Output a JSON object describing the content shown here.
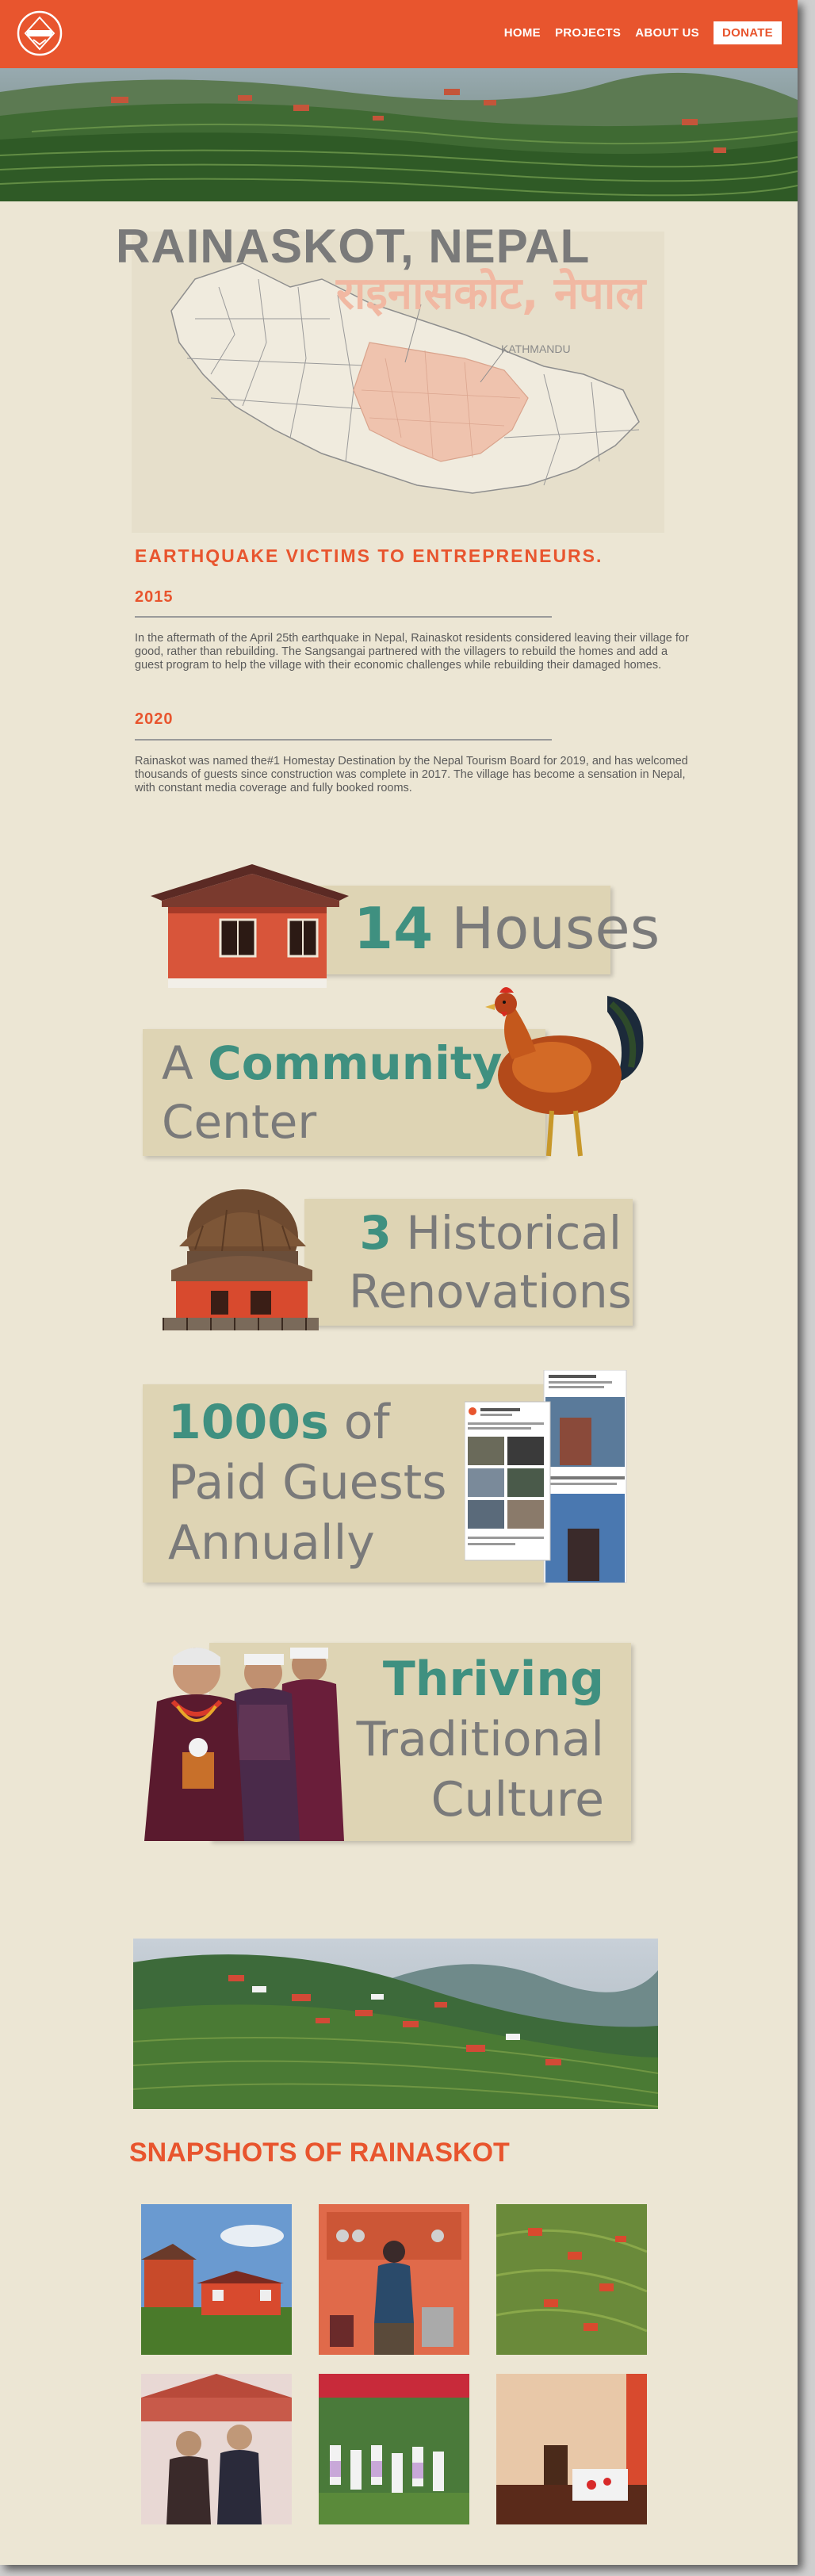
{
  "nav": {
    "logo_label": "logo",
    "items": [
      "HOME",
      "PROJECTS",
      "ABOUT US"
    ],
    "donate": "DONATE"
  },
  "header": {
    "title_en": "RAINASKOT, NEPAL",
    "title_np": "राइनासकोट, नेपाल",
    "map_label": "KATHMANDU"
  },
  "story": {
    "heading": "EARTHQUAKE VICTIMS TO ENTREPRENEURS.",
    "entries": [
      {
        "year": "2015",
        "text": "In the aftermath of the April 25th earthquake in Nepal, Rainaskot residents considered leaving their village for good, rather than rebuilding. The Sangsangai partnered with the villagers to rebuild the homes and add a guest program to help the village with their economic challenges while rebuilding their damaged homes."
      },
      {
        "year": "2020",
        "text": "Rainaskot was named the#1 Homestay Destination by the Nepal Tourism Board for 2019, and has welcomed thousands of guests since construction was complete in 2017. The village has become a sensation in Nepal, with constant media coverage and fully booked rooms."
      }
    ]
  },
  "stats": {
    "houses": {
      "num": "14",
      "label": "Houses"
    },
    "community": {
      "pre": "A",
      "bold": "Community",
      "post": "Center"
    },
    "renovations": {
      "num": "3",
      "label1": "Historical",
      "label2": "Renovations"
    },
    "guests": {
      "num": "1000s",
      "of": "of",
      "line2": "Paid Guests",
      "line3": "Annually"
    },
    "culture": {
      "bold": "Thriving",
      "line2": "Traditional",
      "line3": "Culture"
    }
  },
  "gallery": {
    "heading": "SNAPSHOTS OF RAINASKOT"
  },
  "colors": {
    "accent": "#e8552e",
    "teal": "#3f9080",
    "page_bg": "#ece6d4",
    "card_bg": "#ded4b4"
  }
}
